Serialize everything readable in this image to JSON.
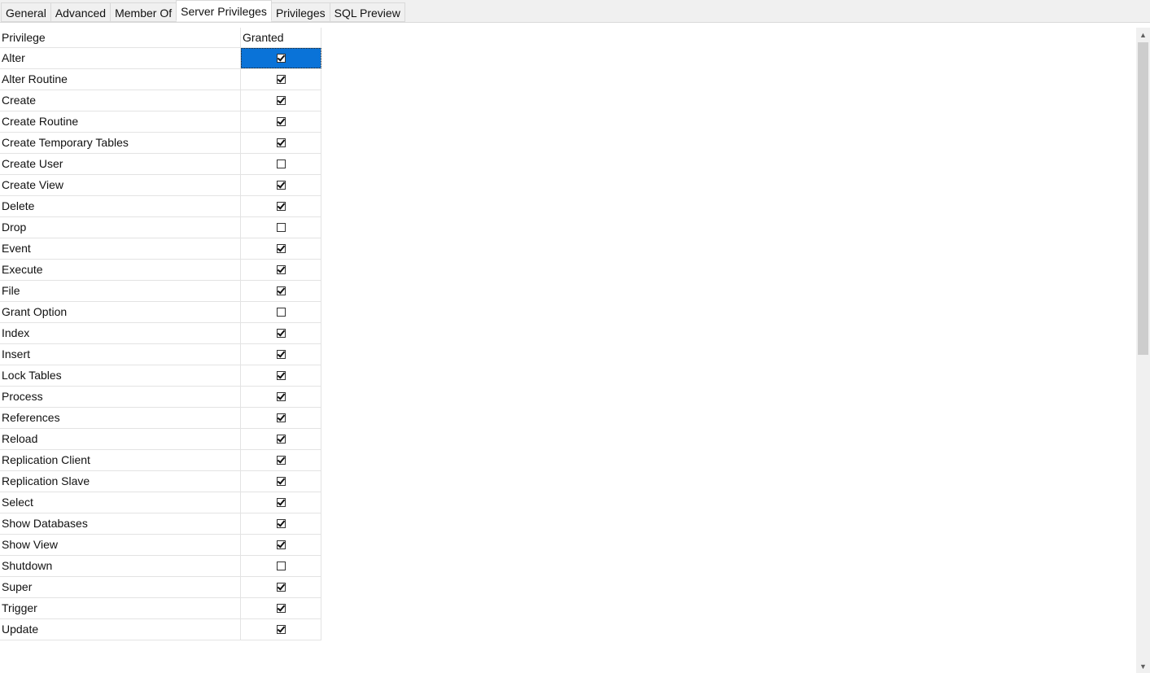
{
  "tabs": [
    {
      "label": "General",
      "active": false
    },
    {
      "label": "Advanced",
      "active": false
    },
    {
      "label": "Member Of",
      "active": false
    },
    {
      "label": "Server Privileges",
      "active": true
    },
    {
      "label": "Privileges",
      "active": false
    },
    {
      "label": "SQL Preview",
      "active": false
    }
  ],
  "grid": {
    "columns": [
      "Privilege",
      "Granted"
    ],
    "rows": [
      {
        "privilege": "Alter",
        "granted": true,
        "selected": true
      },
      {
        "privilege": "Alter Routine",
        "granted": true
      },
      {
        "privilege": "Create",
        "granted": true
      },
      {
        "privilege": "Create Routine",
        "granted": true
      },
      {
        "privilege": "Create Temporary Tables",
        "granted": true
      },
      {
        "privilege": "Create User",
        "granted": false
      },
      {
        "privilege": "Create View",
        "granted": true
      },
      {
        "privilege": "Delete",
        "granted": true
      },
      {
        "privilege": "Drop",
        "granted": false
      },
      {
        "privilege": "Event",
        "granted": true
      },
      {
        "privilege": "Execute",
        "granted": true
      },
      {
        "privilege": "File",
        "granted": true
      },
      {
        "privilege": "Grant Option",
        "granted": false
      },
      {
        "privilege": "Index",
        "granted": true
      },
      {
        "privilege": "Insert",
        "granted": true
      },
      {
        "privilege": "Lock Tables",
        "granted": true
      },
      {
        "privilege": "Process",
        "granted": true
      },
      {
        "privilege": "References",
        "granted": true
      },
      {
        "privilege": "Reload",
        "granted": true
      },
      {
        "privilege": "Replication Client",
        "granted": true
      },
      {
        "privilege": "Replication Slave",
        "granted": true
      },
      {
        "privilege": "Select",
        "granted": true
      },
      {
        "privilege": "Show Databases",
        "granted": true
      },
      {
        "privilege": "Show View",
        "granted": true
      },
      {
        "privilege": "Shutdown",
        "granted": false
      },
      {
        "privilege": "Super",
        "granted": true
      },
      {
        "privilege": "Trigger",
        "granted": true
      },
      {
        "privilege": "Update",
        "granted": true
      }
    ]
  },
  "scrollbar": {
    "up_icon": "scroll-up-arrow-icon",
    "down_icon": "scroll-down-arrow-icon",
    "up_glyph": "▲",
    "down_glyph": "▼"
  },
  "colors": {
    "selection": "#0a73d8",
    "tabbar_bg": "#f0f0f0",
    "gridline": "#e3e3e3"
  }
}
